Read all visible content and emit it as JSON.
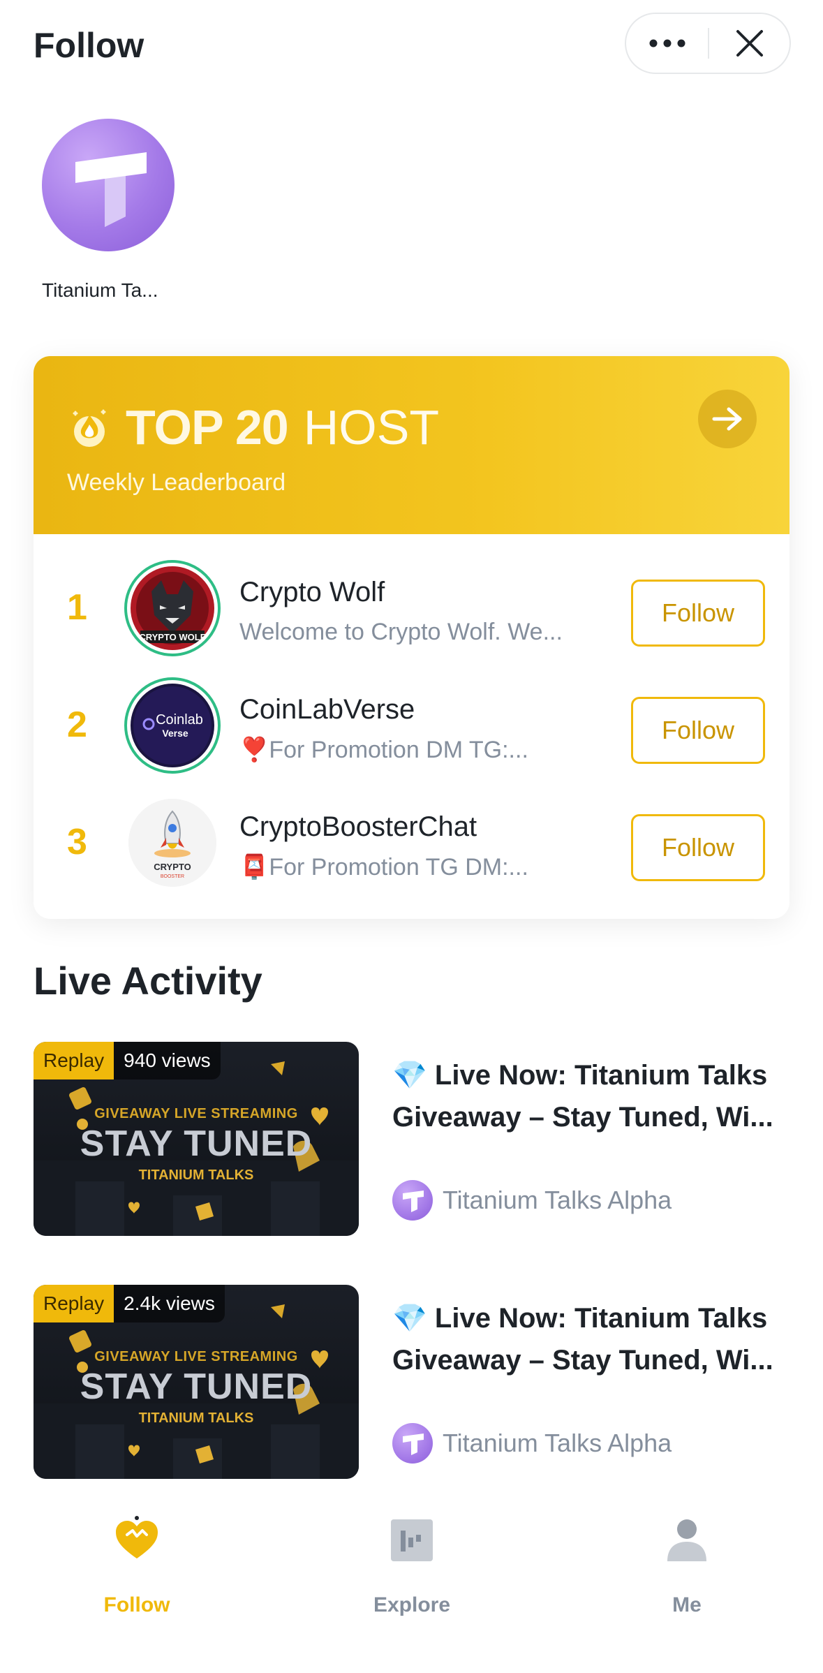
{
  "header": {
    "title": "Follow",
    "more_icon": "more-dots-icon",
    "close_icon": "close-icon"
  },
  "followed": [
    {
      "name": "Titanium Ta..."
    }
  ],
  "leaderboard": {
    "title_bold": "TOP 20",
    "title_light": "HOST",
    "subtitle": "Weekly Leaderboard",
    "accent": "#f0b90b",
    "rows": [
      {
        "rank": "1",
        "name": "Crypto Wolf",
        "desc": "Welcome to Crypto Wolf. We...",
        "button": "Follow"
      },
      {
        "rank": "2",
        "name": "CoinLabVerse",
        "desc": "❣️For Promotion DM TG:...",
        "button": "Follow"
      },
      {
        "rank": "3",
        "name": "CryptoBoosterChat",
        "desc": "📮For Promotion TG DM:...",
        "button": "Follow"
      }
    ]
  },
  "live_activity": {
    "title": "Live Activity",
    "items": [
      {
        "badge": "Replay",
        "views": "940 views",
        "thumb_small": "GIVEAWAY LIVE STREAMING",
        "thumb_big": "STAY TUNED",
        "thumb_brand": "TITANIUM TALKS",
        "title_line1": "💎 Live Now: Titanium Talks",
        "title_line2": "Giveaway – Stay Tuned, Wi...",
        "author": "Titanium Talks Alpha"
      },
      {
        "badge": "Replay",
        "views": "2.4k views",
        "thumb_small": "GIVEAWAY LIVE STREAMING",
        "thumb_big": "STAY TUNED",
        "thumb_brand": "TITANIUM TALKS",
        "title_line1": "💎 Live Now: Titanium Talks",
        "title_line2": "Giveaway – Stay Tuned, Wi...",
        "author": "Titanium Talks Alpha"
      }
    ]
  },
  "tabbar": {
    "tabs": [
      {
        "label": "Follow",
        "icon": "heart-icon",
        "active": true,
        "color": "#f0b90b"
      },
      {
        "label": "Explore",
        "icon": "explore-icon",
        "active": false,
        "color": "#848e9c"
      },
      {
        "label": "Me",
        "icon": "person-icon",
        "active": false,
        "color": "#848e9c"
      }
    ]
  }
}
